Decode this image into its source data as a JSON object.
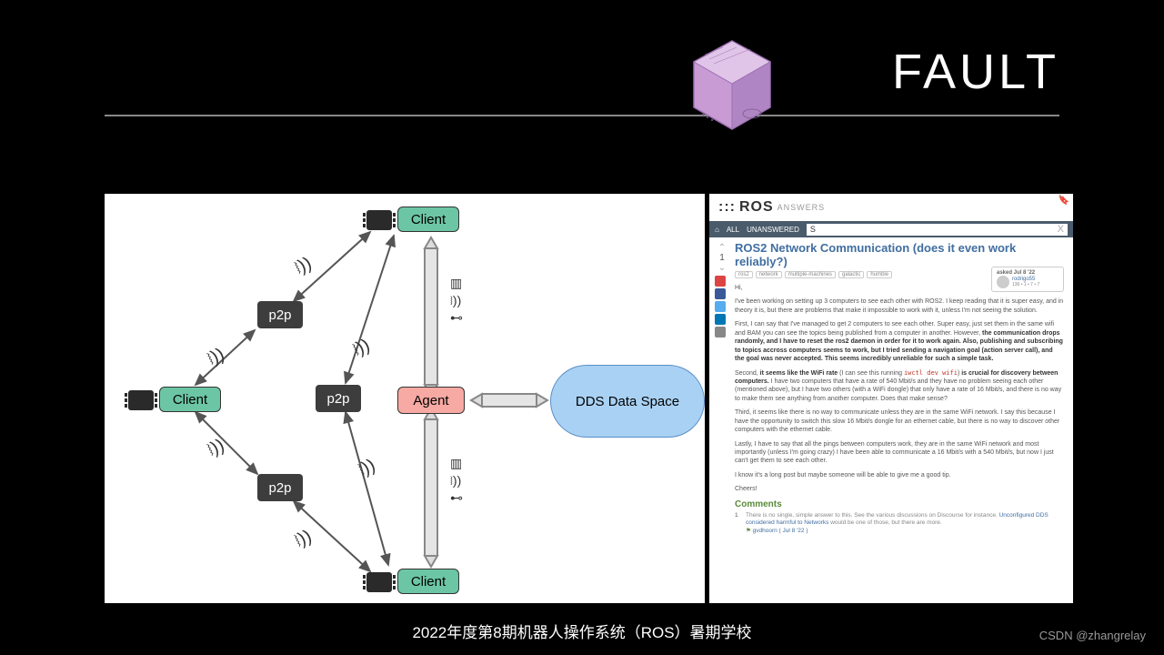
{
  "slide": {
    "title": "FAULT",
    "footer": "2022年度第8期机器人操作系统（ROS）暑期学校",
    "watermark": "CSDN @zhangrelay"
  },
  "diagram": {
    "clients": [
      "Client",
      "Client",
      "Client"
    ],
    "p2p": [
      "p2p",
      "p2p",
      "p2p"
    ],
    "agent": "Agent",
    "cloud": "DDS Data Space",
    "connections": [
      "wifi",
      "ethernet",
      "usb"
    ]
  },
  "ros": {
    "logo_prefix": ":::",
    "logo": "ROS",
    "logo_suffix": "ANSWERS",
    "nav": {
      "home": "⌂",
      "all": "ALL",
      "unanswered": "UNANSWERED"
    },
    "search": {
      "value": "S",
      "clear": "X"
    },
    "vote": {
      "up": "⌃",
      "count": "1",
      "down": "⌄"
    },
    "question": {
      "title": "ROS2 Network Communication (does it even work reliably?)",
      "tags": [
        "ros2",
        "network",
        "multiple-machines",
        "galactic",
        "humble"
      ],
      "asked": {
        "label": "asked Jul 8 '22",
        "user": "rodrigo55",
        "stats": "136 • 1 • 7 • 7"
      },
      "greeting": "Hi,",
      "p1": "I've been working on setting up 3 computers to see each other with ROS2. I keep reading that it is super easy, and in theory it is, but there are problems that make it impossible to work with it, unless I'm not seeing the solution.",
      "p2a": "First, I can say that I've managed to get 2 computers to see each other. Super easy, just set them in the same wifi and BAM you can see the topics being published from a computer in another. However, ",
      "p2b": "the communication drops randomly, and I have to reset the ros2 daemon in order for it to work again. Also, publishing and subscribing to topics accross computers seems to work, but I tried sending a navigation goal (action server call), and the goal was never accepted. This seems incredibly unreliable for such a simple task.",
      "p3a": "Second, ",
      "p3b": "it seems like the WiFi rate",
      "p3c": " (I can see this running ",
      "p3code": "iwctl dev wifi",
      "p3d": ") ",
      "p3e": "is crucial for discovery between computers.",
      "p3f": " I have two computers that have a rate of 540 Mbit/s and they have no problem seeing each other (mentioned above), but I have two others (with a WiFi dongle) that only have a rate of 16 Mbit/s, and there is no way to make them see anything from another computer. Does that make sense?",
      "p4": "Third, it seems like there is no way to communicate unless they are in the same WiFi network. I say this because I have the opportunity to switch this slow 16 Mbit/s dongle for an ethernet cable, but there is no way to discover other computers with the ethernet cable.",
      "p5": "Lastly, I have to say that all the pings between computers work, they are in the same WiFi network and most importantly (unless I'm going crazy) I have been able to communicate a 16 Mbit/s with a 540 Mbit/s, but now I just can't get them to see each other.",
      "p6": "I know it's a long post but maybe someone will be able to give me a good tip.",
      "p7": "Cheers!"
    },
    "comments": {
      "heading": "Comments",
      "c1n": "1",
      "c1a": "There is no single, simple answer to this. See the various discussions on Discourse for instance. ",
      "c1link": "Unconfigured DDS considered harmful to Networks",
      "c1b": " would be one of those, but there are more.",
      "c1meta": "gvdhoorn  ( Jul 8 '22 )"
    }
  }
}
